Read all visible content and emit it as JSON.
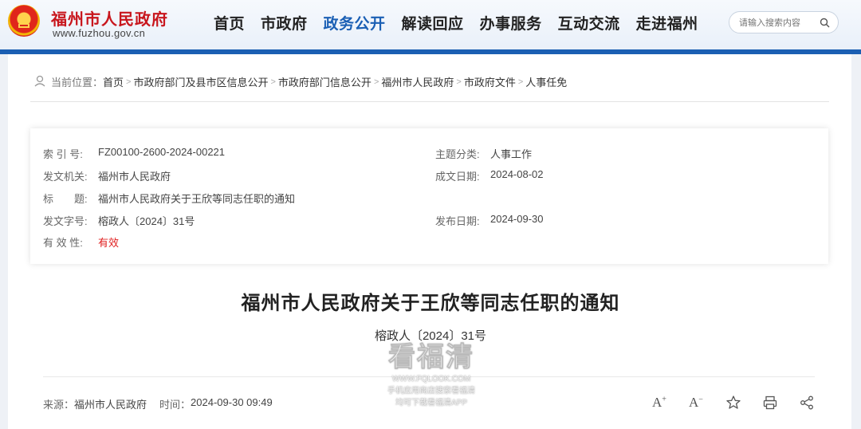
{
  "header": {
    "site_name": "福州市人民政府",
    "site_url": "www.fuzhou.gov.cn",
    "nav": [
      "首页",
      "市政府",
      "政务公开",
      "解读回应",
      "办事服务",
      "互动交流",
      "走进福州"
    ],
    "active_nav_index": 2,
    "search_placeholder": "请输入搜索内容"
  },
  "breadcrumb": {
    "label": "当前位置：",
    "items": [
      "首页",
      "市政府部门及县市区信息公开",
      "市政府部门信息公开",
      "福州市人民政府",
      "市政府文件",
      "人事任免"
    ]
  },
  "info": {
    "index_label": "索 引 号:",
    "index_value": "FZ00100-2600-2024-00221",
    "topic_label": "主题分类:",
    "topic_value": "人事工作",
    "issuer_label": "发文机关:",
    "issuer_value": "福州市人民政府",
    "written_label": "成文日期:",
    "written_value": "2024-08-02",
    "title_label": "标　　题:",
    "title_value": "福州市人民政府关于王欣等同志任职的通知",
    "docno_label": "发文字号:",
    "docno_value": "榕政人〔2024〕31号",
    "published_label": "发布日期:",
    "published_value": "2024-09-30",
    "validity_label": "有 效 性:",
    "validity_value": "有效"
  },
  "article": {
    "title": "福州市人民政府关于王欣等同志任职的通知",
    "doc_number": "榕政人〔2024〕31号"
  },
  "footer": {
    "source_label": "来源：",
    "source_value": "福州市人民政府",
    "time_label": "时间：",
    "time_value": "2024-09-30 09:49",
    "font_increase": "A",
    "font_decrease": "A"
  },
  "watermark": {
    "brand": "看福清",
    "url": "WWW.FQLOOK.COM",
    "line1": "手机应用商店搜索看福清",
    "line2": "均可下载看福清APP"
  },
  "colors": {
    "brand_red": "#c8161d",
    "nav_active": "#1a5fb4",
    "band": "#1b5fb3",
    "valid_red": "#e02020"
  }
}
